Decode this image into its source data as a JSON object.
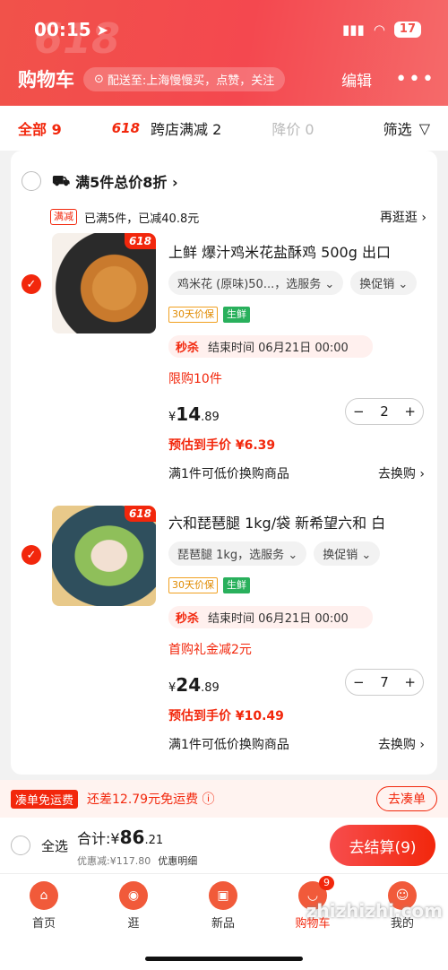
{
  "status_bar": {
    "time": "00:15",
    "battery": "17"
  },
  "header": {
    "title": "购物车",
    "address": "配送至:上海慢慢买，点赞，关注",
    "edit": "编辑",
    "more": "•••",
    "watermark": "618"
  },
  "filters": {
    "all": "全部 9",
    "badge_618": "618",
    "cross_store": "跨店满减 2",
    "price_drop": "降价 0",
    "filter": "筛选"
  },
  "shop": {
    "label": "满5件总价8折 ›"
  },
  "promo": {
    "tag": "满减",
    "text": "已满5件，已减40.8元",
    "more": "再逛逛 ›"
  },
  "items": [
    {
      "badge": "618",
      "title": "上鲜 爆汁鸡米花盐酥鸡 500g 出口",
      "spec": "鸡米花 (原味)50...，选服务 ⌄",
      "promo_chip": "换促销 ⌄",
      "tag1": "30天价保",
      "tag2": "生鲜",
      "sale_label": "秒杀",
      "sale_time": "结束时间 06月21日 00:00",
      "limit": "限购10件",
      "price_sym": "¥",
      "price_int": "14",
      "price_dec": ".89",
      "quantity": "2",
      "estimate": "预估到手价 ¥6.39",
      "swap": "满1件可低价换购商品",
      "swap_go": "去换购 ›"
    },
    {
      "badge": "618",
      "title": "六和琵琶腿 1kg/袋 新希望六和 白",
      "spec": "琵琶腿 1kg，选服务 ⌄",
      "promo_chip": "换促销 ⌄",
      "tag1": "30天价保",
      "tag2": "生鲜",
      "sale_label": "秒杀",
      "sale_time": "结束时间 06月21日 00:00",
      "limit": "首购礼金减2元",
      "price_sym": "¥",
      "price_int": "24",
      "price_dec": ".89",
      "quantity": "7",
      "estimate": "预估到手价 ¥10.49",
      "swap": "满1件可低价换购商品",
      "swap_go": "去换购 ›"
    }
  ],
  "freeship": {
    "tag": "凑单免运费",
    "msg": "还差12.79元免运费 ⓘ",
    "btn": "去凑单"
  },
  "checkout": {
    "select_all": "全选",
    "total_label": "合计:",
    "total_sym": "¥",
    "total_int": "86",
    "total_dec": ".21",
    "discount": "优惠减:¥117.80",
    "detail": "优惠明细",
    "btn": "去结算(9)"
  },
  "tabs": [
    {
      "label": "首页",
      "active": false
    },
    {
      "label": "逛",
      "active": false
    },
    {
      "label": "新品",
      "active": false
    },
    {
      "label": "购物车",
      "active": true,
      "count": "9"
    },
    {
      "label": "我的",
      "active": false
    }
  ],
  "watermark": "zhizhizhi.com",
  "colors": {
    "accent": "#f2270c",
    "header": "#f1524a"
  }
}
